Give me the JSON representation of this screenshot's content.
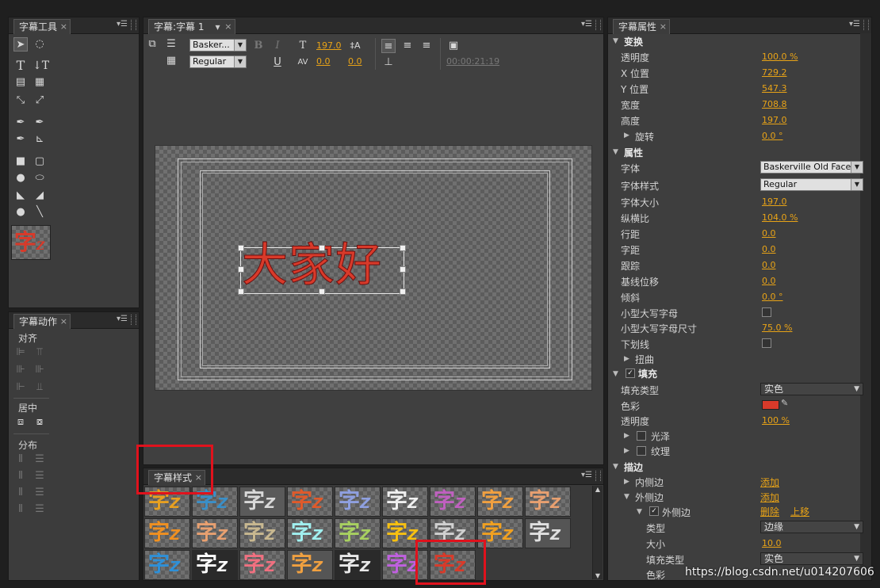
{
  "tools_panel": {
    "tab": "字幕工具",
    "preview_char": "字"
  },
  "actions_panel": {
    "tab": "字幕动作",
    "align_label": "对齐",
    "center_label": "居中",
    "distribute_label": "分布"
  },
  "title_panel": {
    "tab": "字幕:字幕 1",
    "font_family": "Basker...",
    "font_style": "Regular",
    "font_size": "197.0",
    "kerning": "0.0",
    "tracking": "0.0",
    "timecode": "00:00:21:19",
    "bold": "B",
    "italic": "I",
    "underline": "U",
    "canvas_text": "大家好"
  },
  "styles_panel": {
    "tab": "字幕样式",
    "swatch_char": "字",
    "swatch_suffix": "Z",
    "swatches": [
      {
        "c": "#e8a020",
        "bg": "checker"
      },
      {
        "c": "#3a8fc8",
        "bg": "checker"
      },
      {
        "c": "#d9d9d9",
        "bg": "#5a5a5a"
      },
      {
        "c": "#e05a2a",
        "bg": "checker"
      },
      {
        "c": "#8fa0e0",
        "bg": "checker"
      },
      {
        "c": "#f0f0f0",
        "bg": "checker"
      },
      {
        "c": "#c060c0",
        "bg": "checker"
      },
      {
        "c": "#f0a040",
        "bg": "checker"
      },
      {
        "c": "#e8a070",
        "bg": "checker"
      },
      {
        "c": "#f09020",
        "bg": "checker"
      },
      {
        "c": "#e8a070",
        "bg": "checker"
      },
      {
        "c": "#c8b890",
        "bg": "checker"
      },
      {
        "c": "#a0f0f0",
        "bg": "checker"
      },
      {
        "c": "#a8d060",
        "bg": "checker"
      },
      {
        "c": "#f8c010",
        "bg": "checker"
      },
      {
        "c": "#d0d0d0",
        "bg": "checker"
      },
      {
        "c": "#f0a020",
        "bg": "checker"
      },
      {
        "c": "#e0e0e0",
        "bg": "#555"
      },
      {
        "c": "#2e90d8",
        "bg": "checker"
      },
      {
        "c": "#ffffff",
        "bg": "#2a2a2a"
      },
      {
        "c": "#f07080",
        "bg": "checker"
      },
      {
        "c": "#f0a040",
        "bg": "#555"
      },
      {
        "c": "#e8e8e8",
        "bg": "#2a2a2a"
      },
      {
        "c": "#c060e0",
        "bg": "checker"
      },
      {
        "c": "#d83a2a",
        "bg": "checker"
      }
    ]
  },
  "props_panel": {
    "tab": "字幕属性",
    "transform": "变换",
    "opacity_label": "透明度",
    "opacity": "100.0 %",
    "x_label": "X 位置",
    "x": "729.2",
    "y_label": "Y 位置",
    "y": "547.3",
    "width_label": "宽度",
    "width": "708.8",
    "height_label": "高度",
    "height": "197.0",
    "rotation_label": "旋转",
    "rotation": "0.0 °",
    "properties": "属性",
    "font_label": "字体",
    "font": "Baskerville Old Face",
    "font_style_label": "字体样式",
    "font_style": "Regular",
    "font_size_label": "字体大小",
    "font_size": "197.0",
    "aspect_label": "纵横比",
    "aspect": "104.0 %",
    "leading_label": "行距",
    "leading": "0.0",
    "kerning_label": "字距",
    "kerning": "0.0",
    "tracking_label": "跟踪",
    "tracking": "0.0",
    "baseline_label": "基线位移",
    "baseline": "0.0",
    "slant_label": "倾斜",
    "slant": "0.0 °",
    "smallcaps_label": "小型大写字母",
    "smallcaps_size_label": "小型大写字母尺寸",
    "smallcaps_size": "75.0 %",
    "underline_label": "下划线",
    "distort_label": "扭曲",
    "fill": "填充",
    "fill_type_label": "填充类型",
    "fill_type": "实色",
    "color_label": "色彩",
    "fill_color": "#d83a2a",
    "fill_opacity_label": "透明度",
    "fill_opacity": "100 %",
    "sheen_label": "光泽",
    "texture_label": "纹理",
    "stroke": "描边",
    "inner_stroke_label": "内侧边",
    "add1": "添加",
    "outer_stroke_label": "外侧边",
    "add2": "添加",
    "outer_item_label": "外侧边",
    "delete": "删除",
    "move_up": "上移",
    "type_label": "类型",
    "type": "边缘",
    "size_label": "大小",
    "size": "10.0",
    "stroke_fill_label": "填充类型",
    "stroke_fill": "实色",
    "stroke_color_label": "色彩"
  },
  "watermark": "https://blog.csdn.net/u014207606"
}
